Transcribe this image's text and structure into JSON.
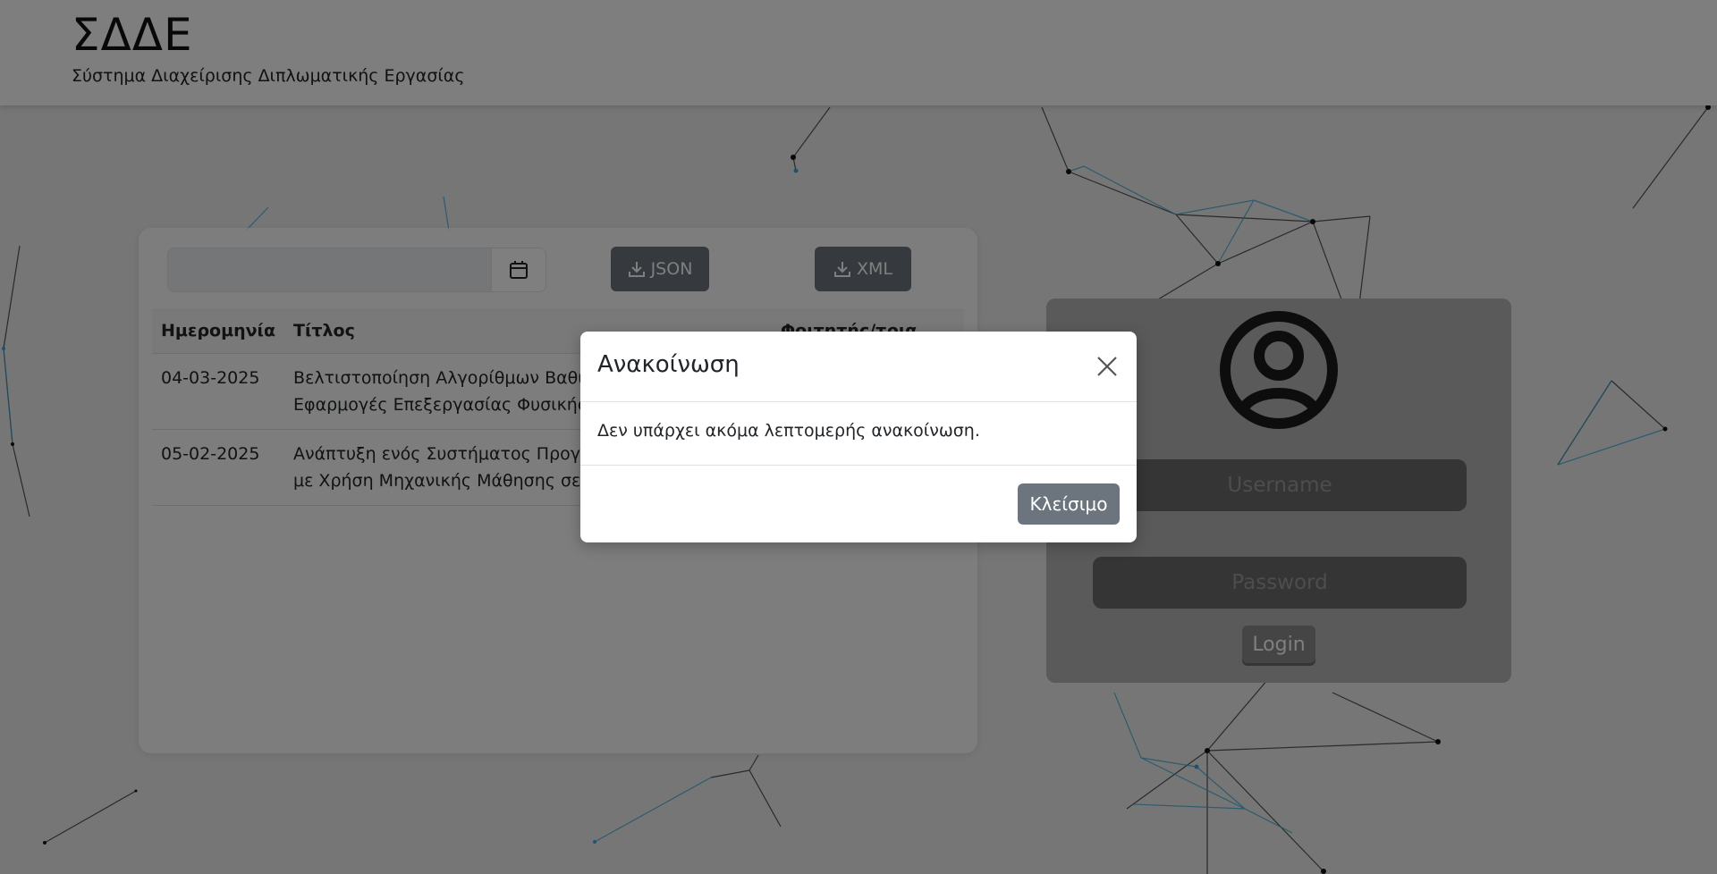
{
  "header": {
    "title": "ΣΔΔΕ",
    "subtitle": "Σύστημα Διαχείρισης Διπλωματικής Εργασίας"
  },
  "announcements": {
    "date_filter": {
      "value": "",
      "icon": "calendar-icon"
    },
    "download_json_label": "JSON",
    "download_xml_label": "XML",
    "download_icon": "download-icon",
    "columns": [
      "Ημερομηνία",
      "Τίτλος",
      "Φοιτητής/τρια"
    ],
    "rows": [
      {
        "date": "04-03-2025",
        "title_line1": "Βελτιστοποίηση Αλγορίθμων Βαθιά",
        "title_line2": "Εφαρμογές Επεξεργασίας Φυσικής"
      },
      {
        "date": "05-02-2025",
        "title_line1": "Ανάπτυξη ενός Συστήματος Προγνω",
        "title_line2": "με Χρήση Μηχανικής Μάθησης σε Ε"
      }
    ]
  },
  "login": {
    "avatar_icon": "user-circle-icon",
    "username_placeholder": "Username",
    "password_placeholder": "Password",
    "button_label": "Login"
  },
  "modal": {
    "title": "Ανακοίνωση",
    "body": "Δεν υπάρχει ακόμα λεπτομερής ανακοίνωση.",
    "close_button_label": "Κλείσιμο",
    "close_icon": "close-icon"
  },
  "colors": {
    "button_gray": "#6c757d",
    "network_blue": "#3aa9d8",
    "network_dark": "#222222"
  }
}
